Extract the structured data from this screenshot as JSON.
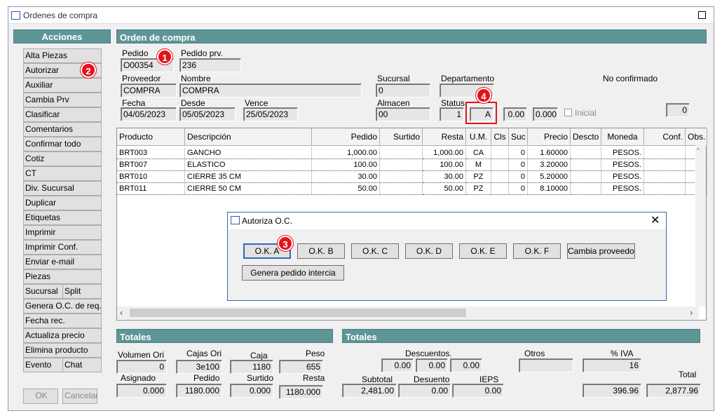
{
  "window": {
    "title": "Ordenes de compra"
  },
  "acciones": {
    "title": "Acciones",
    "items": [
      "Alta Piezas",
      "Autorizar",
      "Auxiliar",
      "Cambia Prv",
      "Clasificar",
      "Comentarios",
      "Confirmar todo",
      "Cotiz",
      "CT",
      "Div. Sucursal",
      "Duplicar",
      "Etiquetas",
      "Imprimir",
      "Imprimir Conf.",
      "Enviar e-mail",
      "Piezas",
      "Sucursal",
      "Split",
      "Genera O.C. de req.",
      "Fecha rec.",
      "Actualiza precio",
      "Elimina producto",
      "Evento",
      "Chat"
    ],
    "ok": "OK",
    "cancel": "Cancelar"
  },
  "orden": {
    "title": "Orden de compra",
    "pedido_label": "Pedido",
    "pedido": "O00354",
    "pedido_prv_label": "Pedido prv.",
    "pedido_prv": "236",
    "proveedor_label": "Proveedor",
    "proveedor": "COMPRA",
    "nombre_label": "Nombre",
    "nombre": "COMPRA",
    "sucursal_label": "Sucursal",
    "sucursal": "0",
    "departamento_label": "Departamento",
    "departamento": "",
    "status_text": "No confirmado",
    "fecha_label": "Fecha",
    "fecha": "04/05/2023",
    "desde_label": "Desde",
    "desde": "05/05/2023",
    "vence_label": "Vence",
    "vence": "25/05/2023",
    "almacen_label": "Almacen",
    "almacen": "00",
    "status_label": "Status",
    "status_num": "1",
    "status_code": "A",
    "val1": "0.00",
    "val2": "0.000",
    "inicial_label": "Inicial",
    "right_val": "0"
  },
  "grid": {
    "headers": [
      "Producto",
      "Descripción",
      "Pedido",
      "Surtido",
      "Resta",
      "U.M.",
      "Cls",
      "Suc",
      "Precio",
      "Descto",
      "Moneda",
      "Conf.",
      "Obs."
    ],
    "rows": [
      [
        "BRT003",
        "GANCHO",
        "1,000.00",
        "",
        "1,000.00",
        "CA",
        "",
        "0",
        "1.60000",
        "",
        "PESOS.",
        "",
        ""
      ],
      [
        "BRT007",
        "ELASTICO",
        "100.00",
        "",
        "100.00",
        "M",
        "",
        "0",
        "3.20000",
        "",
        "PESOS.",
        "",
        ""
      ],
      [
        "BRT010",
        "CIERRE 35 CM",
        "30.00",
        "",
        "30.00",
        "PZ",
        "",
        "0",
        "5.20000",
        "",
        "PESOS.",
        "",
        ""
      ],
      [
        "BRT011",
        "CIERRE 50 CM",
        "50.00",
        "",
        "50.00",
        "PZ",
        "",
        "0",
        "8.10000",
        "",
        "PESOS.",
        "",
        ""
      ]
    ]
  },
  "dialog": {
    "title": "Autoriza O.C.",
    "buttons": [
      "O.K. A",
      "O.K. B",
      "O.K. C",
      "O.K. D",
      "O.K. E",
      "O.K. F",
      "Cambia proveedor"
    ],
    "genera": "Genera pedido intercia"
  },
  "totales1": {
    "title": "Totales",
    "vol_label": "Volumen Ori",
    "vol": "0",
    "cajas_ori_label": "Cajas Ori",
    "cajas_ori": "3e100",
    "caja_label": "Caja",
    "caja": "1180",
    "peso_label": "Peso",
    "peso": "655",
    "asignado_label": "Asignado",
    "asignado": "0.000",
    "pedido_label": "Pedido",
    "pedido": "1180.000",
    "surtido_label": "Surtido",
    "surtido": "0.000",
    "resta_label": "Resta",
    "resta": "1180.000"
  },
  "totales2": {
    "title": "Totales",
    "descuentos_label": "Descuentos.",
    "d1": "0.00",
    "d2": "0.00",
    "d3": "0.00",
    "otros_label": "Otros",
    "otros": "",
    "iva_label": "% IVA",
    "iva": "16",
    "subtotal_label": "Subtotal",
    "subtotal": "2,481.00",
    "desuento_label": "Desuento",
    "desuento": "0.00",
    "ieps_label": "IEPS",
    "ieps": "0.00",
    "iva_amount": "396.96",
    "total_label": "Total",
    "total": "2,877.96"
  },
  "badges": [
    "1",
    "2",
    "3",
    "4"
  ],
  "colors": {
    "panel_head": "#5e9597",
    "badge": "#e3131b"
  }
}
